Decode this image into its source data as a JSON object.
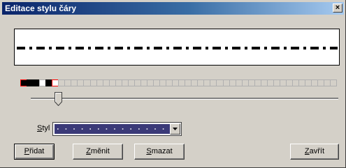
{
  "window": {
    "title": "Editace stylu čáry",
    "close_glyph": "×"
  },
  "pattern": {
    "cells": [
      "black",
      "black",
      "black",
      "white",
      "black",
      "white"
    ],
    "total_cells": 50,
    "selection_color": "#ff0000"
  },
  "slider": {
    "position_fraction": 0.08
  },
  "style": {
    "label_accel": "S",
    "label_rest": "tyl",
    "selected_value": "dotted line"
  },
  "buttons": {
    "add": {
      "accel": "P",
      "rest": "řidat"
    },
    "change": {
      "accel": "Z",
      "rest": "měnit"
    },
    "delete": {
      "accel": "S",
      "rest": "mazat"
    },
    "close": {
      "accel": "Z",
      "rest": "avřít"
    }
  },
  "colors": {
    "title_gradient_start": "#0a246a",
    "title_gradient_end": "#a6caf0",
    "combo_field": "#3b3a78"
  }
}
